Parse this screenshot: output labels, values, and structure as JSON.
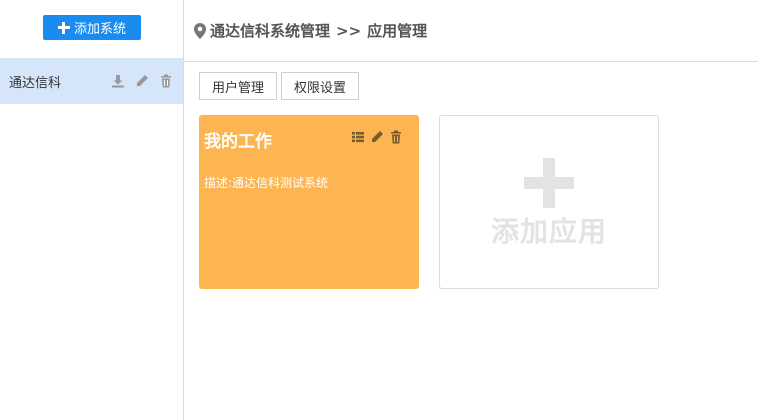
{
  "sidebar": {
    "add_button_label": "添加系统",
    "items": [
      {
        "label": "通达信科"
      }
    ]
  },
  "header": {
    "breadcrumb": [
      "通达信科系统管理",
      "应用管理"
    ],
    "separator": ">>"
  },
  "tabs": [
    {
      "label": "用户管理"
    },
    {
      "label": "权限设置"
    }
  ],
  "apps": [
    {
      "title": "我的工作",
      "description": "描述:通达信科测试系统"
    }
  ],
  "add_app_label": "添加应用",
  "colors": {
    "primary": "#1a8cf0",
    "selected_bg": "#d6e6fa",
    "card_bg": "#fcb551",
    "placeholder": "#e3e3e3"
  }
}
